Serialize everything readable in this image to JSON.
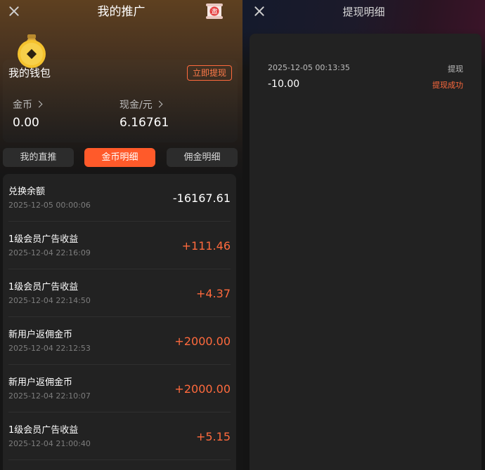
{
  "left_screen": {
    "header": {
      "title": "我的推广",
      "close_icon": "close-icon",
      "invite_icon": "invite-scroll-icon",
      "invite_badge": "邀"
    },
    "wallet": {
      "icon": "money-bag-icon",
      "title": "我的钱包",
      "withdraw_button": "立即提现",
      "coins": {
        "label": "金币",
        "value": "0.00"
      },
      "cash": {
        "label": "现金/元",
        "value": "6.16761"
      }
    },
    "tabs": [
      {
        "label": "我的直推",
        "active": false
      },
      {
        "label": "金币明细",
        "active": true
      },
      {
        "label": "佣金明细",
        "active": false
      }
    ],
    "records": [
      {
        "title": "兑换余额",
        "time": "2025-12-05 00:00:06",
        "amount": "-16167.61",
        "positive": false
      },
      {
        "title": "1级会员广告收益",
        "time": "2025-12-04 22:16:09",
        "amount": "+111.46",
        "positive": true
      },
      {
        "title": "1级会员广告收益",
        "time": "2025-12-04 22:14:50",
        "amount": "+4.37",
        "positive": true
      },
      {
        "title": "新用户返佣金币",
        "time": "2025-12-04 22:12:53",
        "amount": "+2000.00",
        "positive": true
      },
      {
        "title": "新用户返佣金币",
        "time": "2025-12-04 22:10:07",
        "amount": "+2000.00",
        "positive": true
      },
      {
        "title": "1级会员广告收益",
        "time": "2025-12-04 21:00:40",
        "amount": "+5.15",
        "positive": true
      }
    ]
  },
  "right_screen": {
    "header": {
      "title": "提现明细",
      "close_icon": "close-icon"
    },
    "record": {
      "time": "2025-12-05 00:13:35",
      "type": "提现",
      "amount": "-10.00",
      "status": "提现成功"
    }
  },
  "colors": {
    "accent": "#ff5a2a",
    "positive_amount": "#ff6a3d",
    "card_bg": "#222222",
    "page_bg": "#141414"
  }
}
